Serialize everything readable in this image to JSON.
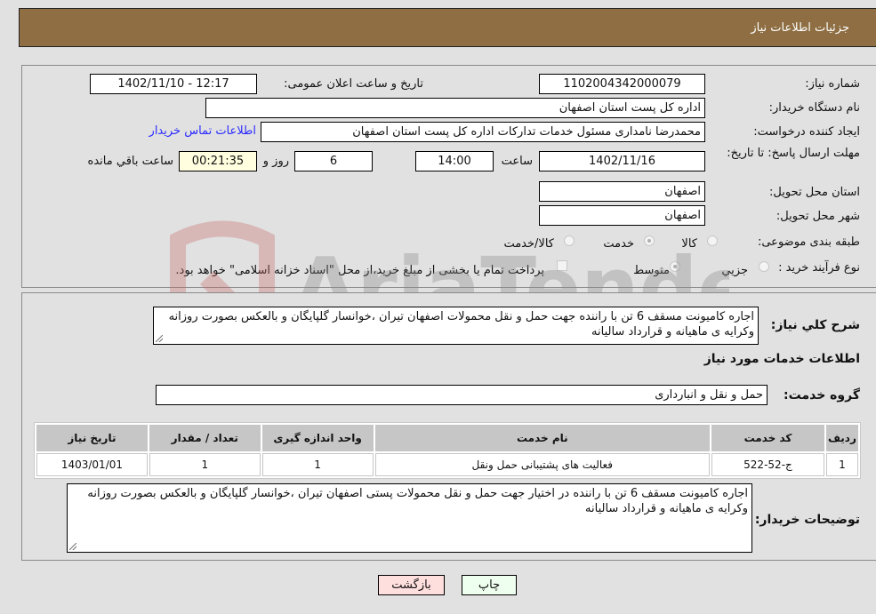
{
  "header": {
    "title": "جزئیات اطلاعات نیاز"
  },
  "fields": {
    "need_number_label": "شماره نیاز:",
    "need_number": "1102004342000079",
    "announce_label": "تاریخ و ساعت اعلان عمومی:",
    "announce_value": "1402/11/10 - 12:17",
    "buyer_org_label": "نام دستگاه خریدار:",
    "buyer_org": "اداره کل پست استان اصفهان",
    "creator_label": "ایجاد کننده درخواست:",
    "creator": "محمدرضا نامداری مسئول خدمات تدارکات اداره کل پست استان اصفهان",
    "contact_link": "اطلاعات تماس خریدار",
    "deadline_label": "مهلت ارسال پاسخ: تا تاریخ:",
    "deadline_date": "1402/11/16",
    "time_label": "ساعت",
    "deadline_time": "14:00",
    "days_value": "6",
    "days_label": "روز و",
    "remaining_value": "00:21:35",
    "remaining_label": "ساعت باقي مانده",
    "province_label": "استان محل تحویل:",
    "province": "اصفهان",
    "city_label": "شهر محل تحویل:",
    "city": "اصفهان",
    "category_label": "طبقه بندی موضوعی:",
    "category_options": [
      {
        "label": "کالا",
        "checked": false
      },
      {
        "label": "خدمت",
        "checked": true
      },
      {
        "label": "کالا/خدمت",
        "checked": false
      }
    ],
    "process_label": "نوع فرآیند خرید :",
    "process_options": [
      {
        "label": "جزيي",
        "checked": false
      },
      {
        "label": "متوسط",
        "checked": true
      }
    ],
    "treasury_note": "پرداخت تمام یا بخشی از مبلغ خرید،از محل \"اسناد خزانه اسلامی\" خواهد بود.",
    "treasury_checked": false
  },
  "description": {
    "label": "شرح کلي نیاز:",
    "text": "اجاره کامیونت مسقف 6 تن با راننده  جهت حمل و نقل محمولات  اصفهان تیران ،خوانسار گلپایگان و بالعکس بصورت روزانه وکرایه ی ماهیانه و قرارداد سالیانه"
  },
  "services": {
    "section_title": "اطلاعات خدمات مورد نیاز",
    "group_label": "گروه خدمت:",
    "group_value": "حمل و نقل و انبارداری",
    "table": {
      "headers": [
        "ردیف",
        "کد خدمت",
        "نام خدمت",
        "واحد اندازه گیری",
        "تعداد / مقدار",
        "تاریخ نیاز"
      ],
      "rows": [
        [
          "1",
          "ج-52-522",
          "فعالیت های پشتیبانی حمل ونقل",
          "1",
          "1",
          "1403/01/01"
        ]
      ]
    }
  },
  "buyer_notes": {
    "label": "توضیحات خریدار:",
    "text": "اجاره کامیونت مسقف 6 تن با راننده در اختیار جهت حمل و نقل محمولات پستی اصفهان تیران ،خوانسار گلپایگان و بالعکس بصورت روزانه وکرایه ی ماهیانه و قرارداد سالیانه"
  },
  "buttons": {
    "print": "چاپ",
    "back": "بازگشت"
  },
  "colors": {
    "header_bg": "#8e6e42",
    "print_bg": "#efffef",
    "back_bg": "#ffdede",
    "link": "#2a2aff",
    "remaining_bg": "#ffffe0"
  },
  "watermark": {
    "text": "AriaTender.neT"
  }
}
